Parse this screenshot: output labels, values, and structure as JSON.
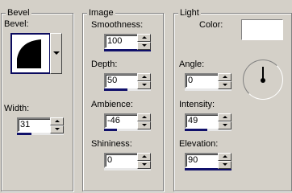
{
  "bevel": {
    "group_title": "Bevel",
    "bevel_label": "Bevel:",
    "width_label": "Width:",
    "width_value": "31"
  },
  "image": {
    "group_title": "Image",
    "smoothness_label": "Smoothness:",
    "smoothness_value": "100",
    "depth_label": "Depth:",
    "depth_value": "50",
    "ambience_label": "Ambience:",
    "ambience_value": "-46",
    "shininess_label": "Shininess:",
    "shininess_value": "0"
  },
  "light": {
    "group_title": "Light",
    "color_label": "Color:",
    "color_value": "#ffffff",
    "angle_label": "Angle:",
    "angle_value": "0",
    "intensity_label": "Intensity:",
    "intensity_value": "49",
    "elevation_label": "Elevation:",
    "elevation_value": "90"
  },
  "slider_fill": {
    "width": 0.31,
    "smoothness": 1.0,
    "depth": 0.5,
    "ambience": 0.27,
    "shininess": 0.0,
    "angle": 0.0,
    "intensity": 0.49,
    "elevation": 1.0
  },
  "colors": {
    "panel": "#d4d0c8",
    "fill_bar": "#10106a",
    "preview_border": "#0a0a5e"
  }
}
